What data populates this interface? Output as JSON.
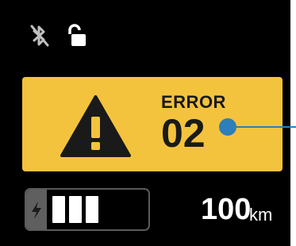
{
  "status_bar": {
    "bluetooth_icon": "bluetooth-disabled-icon",
    "lock_icon": "unlocked-padlock-icon"
  },
  "error": {
    "label": "ERROR",
    "code": "02",
    "icon": "warning-triangle-icon",
    "panel_color": "#f4c33d"
  },
  "battery": {
    "icon": "lightning-bolt-icon",
    "segments_filled": 3,
    "segments_total": 6,
    "level_fraction": 0.5
  },
  "range": {
    "value": "100",
    "unit": "km"
  },
  "colors": {
    "background": "#000000",
    "error_panel": "#f4c33d",
    "callout": "#2c7fb8",
    "foreground": "#ffffff"
  }
}
